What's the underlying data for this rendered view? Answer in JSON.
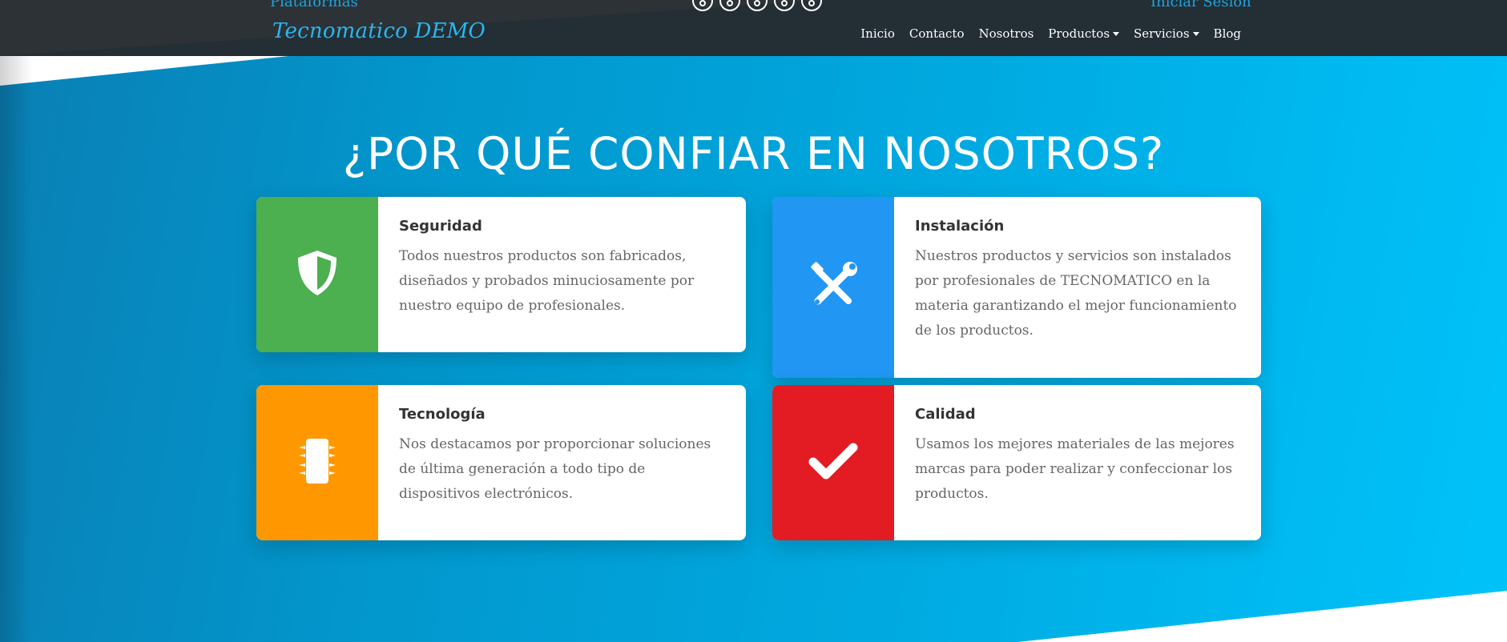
{
  "colors": {
    "navbar": "#242e35",
    "brand": "#29b7ef",
    "hero_start": "#0a7fb4",
    "hero_end": "#00c3fa"
  },
  "topbar": {
    "left_link": "Plataformas",
    "right_link": "Iniciar Sesión",
    "social": [
      "facebook-icon",
      "instagram-icon",
      "whatsapp-icon",
      "phone-icon",
      "copyright-icon"
    ]
  },
  "navbar": {
    "brand": "Tecnomatico DEMO",
    "links": [
      {
        "label": "Inicio",
        "dropdown": false
      },
      {
        "label": "Contacto",
        "dropdown": false
      },
      {
        "label": "Nosotros",
        "dropdown": false
      },
      {
        "label": "Productos",
        "dropdown": true
      },
      {
        "label": "Servicios",
        "dropdown": true
      },
      {
        "label": "Blog",
        "dropdown": false
      }
    ]
  },
  "hero": {
    "title": "¿POR QUÉ CONFIAR EN NOSOTROS?"
  },
  "cards": [
    {
      "title": "Seguridad",
      "text": "Todos nuestros productos son fabricados, diseñados y probados minuciosamente por nuestro equipo de profesionales.",
      "icon": "shield-icon",
      "color": "#4caf50"
    },
    {
      "title": "Instalación",
      "text": "Nuestros productos y servicios son instalados por profesionales de TECNOMATICO en la materia garantizando el mejor funcionamiento de los productos.",
      "icon": "tools-icon",
      "color": "#2196f3"
    },
    {
      "title": "Tecnología",
      "text": "Nos destacamos por proporcionar soluciones de última generación a todo tipo de dispositivos electrónicos.",
      "icon": "microchip-icon",
      "color": "#ff9800"
    },
    {
      "title": "Calidad",
      "text": "Usamos los mejores materiales de las mejores marcas para poder realizar y confeccionar los productos.",
      "icon": "check-icon",
      "color": "#e31b23"
    }
  ]
}
